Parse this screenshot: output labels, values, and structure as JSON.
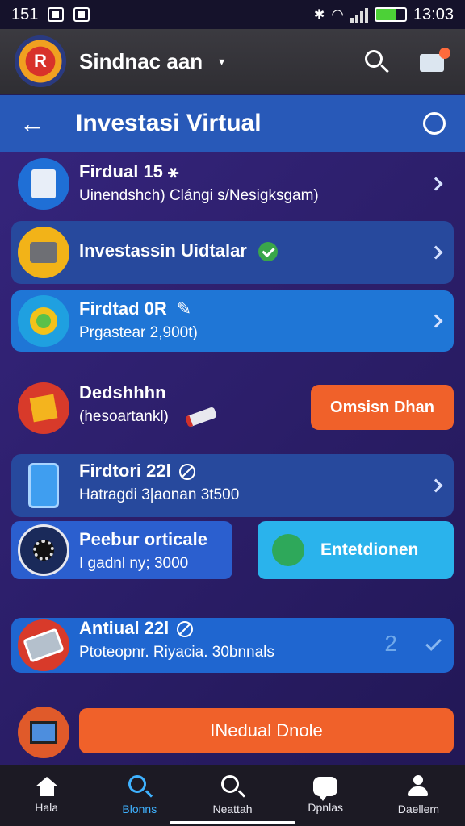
{
  "status_bar": {
    "left_text": "151",
    "time": "13:03"
  },
  "app_bar": {
    "title": "Sindnac aan",
    "logo_text": "R"
  },
  "sub_bar": {
    "title": "Investasi Virtual"
  },
  "items": [
    {
      "title": "Firdual 15 ⚹",
      "subtitle": "Uinendshch) Clángi s/Nesigksgam)"
    },
    {
      "title": "Investassin Uidtalar",
      "subtitle": ""
    },
    {
      "title": "Firdtad 0R",
      "subtitle": "Prgastear 2,900t)"
    },
    {
      "title": "Dedshhhn",
      "subtitle": "(hesoartankl)",
      "button": "Omsisn Dhan"
    },
    {
      "title": "Firdtori 22l",
      "subtitle": "Hatragdi 3|aonan 3t500"
    },
    {
      "title": "Peebur orticale",
      "subtitle": "I gadnl ny; 3000"
    },
    {
      "title": "Antiual 22l",
      "subtitle": "Ptoteopnr. Riyacia. 30bnnals",
      "badge": "2"
    }
  ],
  "right_tab": {
    "label": "Entetdionen"
  },
  "cta": {
    "label": "INedual Dnole"
  },
  "nav": [
    {
      "label": "Hala",
      "icon": "home-icon"
    },
    {
      "label": "Blonns",
      "icon": "search-icon"
    },
    {
      "label": "Neattah",
      "icon": "search-icon"
    },
    {
      "label": "Dpnlas",
      "icon": "chat-icon"
    },
    {
      "label": "Daellem",
      "icon": "person-icon"
    }
  ],
  "colors": {
    "accent": "#3fb2ff",
    "orange": "#f0612a",
    "header_blue": "#2859b8"
  }
}
